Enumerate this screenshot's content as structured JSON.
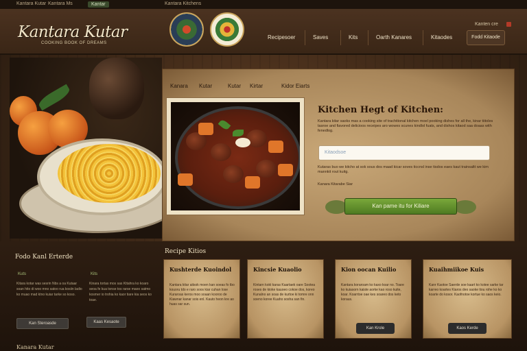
{
  "topbar": {
    "items": [
      "Kantara Kutar",
      "Kantara Ms",
      "Kantar"
    ],
    "center_link": "Kantara Kitchens"
  },
  "header": {
    "logo_title": "Kantara Kutar",
    "logo_tagline": "COOKING BOOK OF DREAMS",
    "nav": [
      "Recipesoer",
      "Saves",
      "Kits",
      "Oarth Kanares",
      "Kitaodes"
    ],
    "cart_label": "Fodd Kitaode",
    "account_label": "Kanten cre"
  },
  "tabs": [
    "Kanara",
    "Kutar",
    "Kutar",
    "Kirtar",
    "Kidor Eiarts"
  ],
  "recipe": {
    "title": "Kitchen Hegt of Kitchen:",
    "description": "Kantara kitar saoks mas a cooking site of trachitional kitchen moel pooking dishes for all the, kinar tiitoles tasroe and fiavored delicioos receipes aro wowes scunes kindlol fuats, and dishos kitaod saa doaas with fenedlog.",
    "search_placeholder": "Kitaodsoe",
    "note": "Kutaras buo we kitcho at sok sous dos maad kicar soves ticcnsl inse tisdos eaes kaut trainsaltt we kim mannkit rout kuitg.",
    "meta": "Kanara Kitarabe Siar",
    "cta_label": "Kan pame itu for Kiliare"
  },
  "bottom": {
    "section_title": "Fodo Kanl Erterde",
    "cards_section_title": "Recipe Kitios",
    "left_columns": [
      {
        "label": "Kuts",
        "text": "Kitara kotar was sesrin Nbs a oa Kutaar soan hito di woo mno satoo rua kosiin ladio ko muao mad ktno kuiar tarke so koso.",
        "button": "Kan Steroasde"
      },
      {
        "label": "Kits",
        "text": "Kinara tortas mos sas Kttahra ko koaro seoa fe kua tonse tos rarse maoo satmo kosmer io trohia ko kaor tiare kia seos ko toae.",
        "button": "Kaas Kesaote"
      }
    ],
    "cards": [
      {
        "title": "Kushterde Kuoindol",
        "body": "Kantara kitar aitsok moen kan soeas fo tbo kouoru tdo e raro soos kiar cuhan lose Kuraroas keros moo soaan kooroo de Kiawnar kanar sois enl. Kauto heon kre ao huas sar sun.",
        "button": ""
      },
      {
        "title": "Kincsie Kuaolio",
        "body": "Kintarn kokt karas Kaartaek oare Sootea roses de kioke kauoeo cokoe dos, koreo Kunalno an soas de kurtoe ki tomre onn soeno koree Kuaho sosha san fin.",
        "button": ""
      },
      {
        "title": "Kion oocan Kuilio",
        "body": "Kantara koraroam ko kaxo koar no. Toare ko kuiasorn kaiste aorke kao roso kuite, koar. Koarrtoe oae kes soareo dos keto koraus.",
        "button": "Kan Krole"
      },
      {
        "title": "Kuaihmiikoe Kuis",
        "body": "Kanr Kaotoe Saerde soe kaart ko kotee sarke tar karreo koartes Kiaros deo saoke tiou rohe ko ko koarte do kosor. Kaofnotoe kortue ko saos keio.",
        "button": "Kaos Kerde"
      }
    ],
    "footer_text": "Kanara Kutar"
  },
  "colors": {
    "wood_dark": "#2a1c12",
    "parchment": "#c9a878",
    "cta_green": "#6a9a32",
    "text_light": "#efe2c2"
  }
}
